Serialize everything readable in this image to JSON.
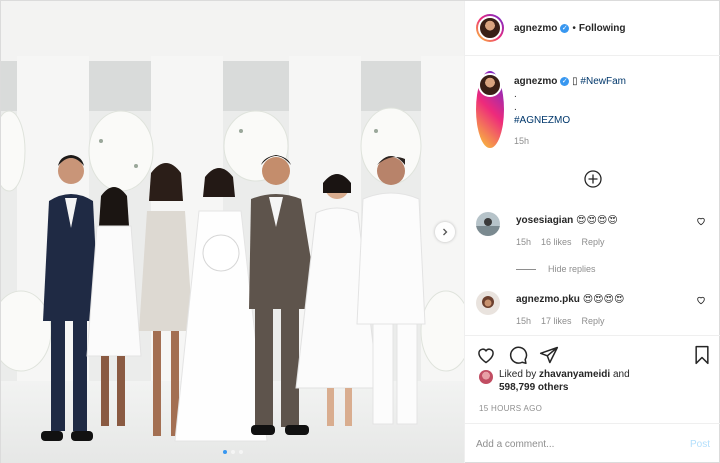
{
  "post": {
    "username": "agnezmo",
    "verified_icon": "verified-check-icon",
    "dot": "•",
    "follow_label": "Following",
    "caption": {
      "emoji": "▯",
      "hashtag1": "#NewFam",
      "line2": ".",
      "line3": ".",
      "hashtag2": "#AGNEZMO",
      "time": "15h"
    },
    "comments": [
      {
        "username": "yosesiagian",
        "text": "😍😍😍😍",
        "time": "15h",
        "likes": "16 likes",
        "reply": "Reply"
      },
      {
        "username": "agnezmo.pku",
        "text": "😍😍😍😍",
        "time": "15h",
        "likes": "17 likes",
        "reply": "Reply"
      }
    ],
    "hide_replies": "Hide replies",
    "liked_by_prefix": "Liked by",
    "liked_by_user": "zhavanyameidi",
    "liked_by_and": "and",
    "liked_by_others": "598,799 others",
    "timestamp": "15 HOURS AGO",
    "add_comment_placeholder": "Add a comment...",
    "post_label": "Post",
    "carousel": {
      "total_slides": 3,
      "active_slide": 1
    },
    "colors": {
      "accent": "#3897f0",
      "link": "#00376b",
      "muted": "#8e8e8e",
      "post_disabled": "#b2dffc"
    }
  }
}
